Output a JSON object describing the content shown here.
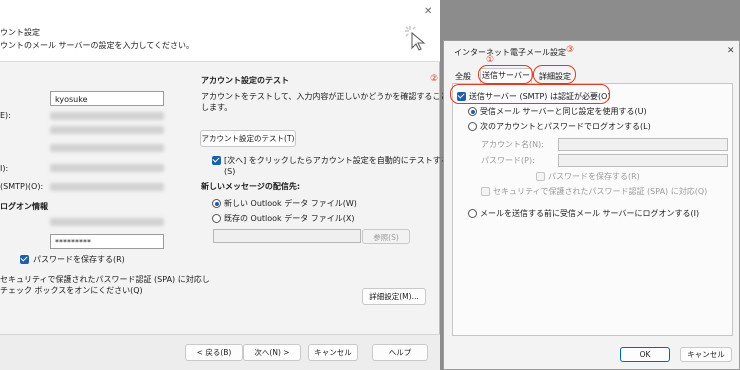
{
  "left": {
    "header_title": "ウント設定",
    "header_subtitle": "ウントのメール サーバーの設定を入力してください。",
    "labels": {
      "e_colon": "E):",
      "i_colon": "I):",
      "smtp_colon": "(SMTP)(O):",
      "logon_info": "ログオン情報"
    },
    "username_value": "kyosuke",
    "password_value": "*********",
    "save_password_label": "パスワードを保存する(R)",
    "spa_line1": "セキュリティで保護されたパスワード認証 (SPA) に対応し",
    "spa_line2": "チェック ボックスをオンにください(Q)",
    "test_section": {
      "title": "アカウント設定のテスト",
      "desc_line1": "アカウントをテストして、入力内容が正しいかどうかを確認することをお勧め",
      "desc_line2": "します。",
      "test_button": "アカウント設定のテスト(T)",
      "auto_test_line1": "[次へ] をクリックしたらアカウント設定を自動的にテストする",
      "auto_test_line2": "(S)"
    },
    "delivery": {
      "title": "新しいメッセージの配信先:",
      "opt_new": "新しい Outlook データ ファイル(W)",
      "opt_existing": "既存の Outlook データ ファイル(X)",
      "browse_button": "参照(S)"
    },
    "more_settings_button": "詳細設定(M)...",
    "footer": {
      "back": "< 戻る(B)",
      "next": "次へ(N) >",
      "cancel": "キャンセル",
      "help": "ヘルプ"
    },
    "close_glyph": "✕"
  },
  "right": {
    "title": "インターネット電子メール設定",
    "close_glyph": "✕",
    "tabs": [
      "全般",
      "送信サーバー",
      "詳細設定"
    ],
    "smtp_auth_label": "送信サーバー (SMTP) は認証が必要(O)",
    "opt_same_as_incoming": "受信メール サーバーと同じ設定を使用する(U)",
    "opt_logon_with": "次のアカウントとパスワードでログオンする(L)",
    "account_name_label": "アカウント名(N):",
    "password_label": "パスワード(P):",
    "remember_password": "パスワードを保存する(R)",
    "spa_label": "セキュリティで保護されたパスワード認証 (SPA) に対応(Q)",
    "opt_logon_before_send": "メールを送信する前に受信メール サーバーにログオンする(I)",
    "ok_button": "OK",
    "cancel_button": "キャンセル"
  },
  "annotations": {
    "num1": "①",
    "num2": "②",
    "num3": "③"
  },
  "colors": {
    "accent": "#1f5fa8",
    "annotation_red": "#e23a22",
    "ok_border": "#0067c0"
  }
}
